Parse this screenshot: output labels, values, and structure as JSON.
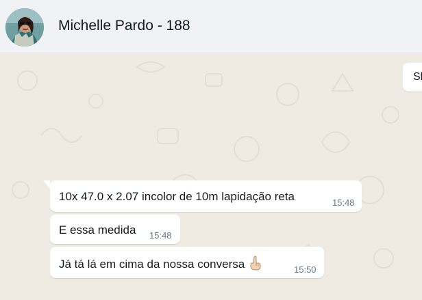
{
  "header": {
    "contact_name": "Michelle Pardo - 188",
    "avatar_icon": "contact-avatar"
  },
  "messages": [
    {
      "direction": "outgoing",
      "text": "Sl",
      "time": ""
    },
    {
      "direction": "incoming",
      "text": "10x 47.0 x 2.07 incolor de 10m lapidação reta",
      "time": "15:48"
    },
    {
      "direction": "incoming",
      "text": "E essa medida",
      "time": "15:48"
    },
    {
      "direction": "incoming",
      "text": "Já tá lá em cima da nossa conversa",
      "emoji": "pointing-up-hand-icon",
      "time": "15:50"
    }
  ],
  "colors": {
    "header_bg": "#f0f2f5",
    "chat_bg": "#efeae2",
    "bubble_bg": "#ffffff",
    "text": "#111b21",
    "timestamp": "#667781"
  }
}
